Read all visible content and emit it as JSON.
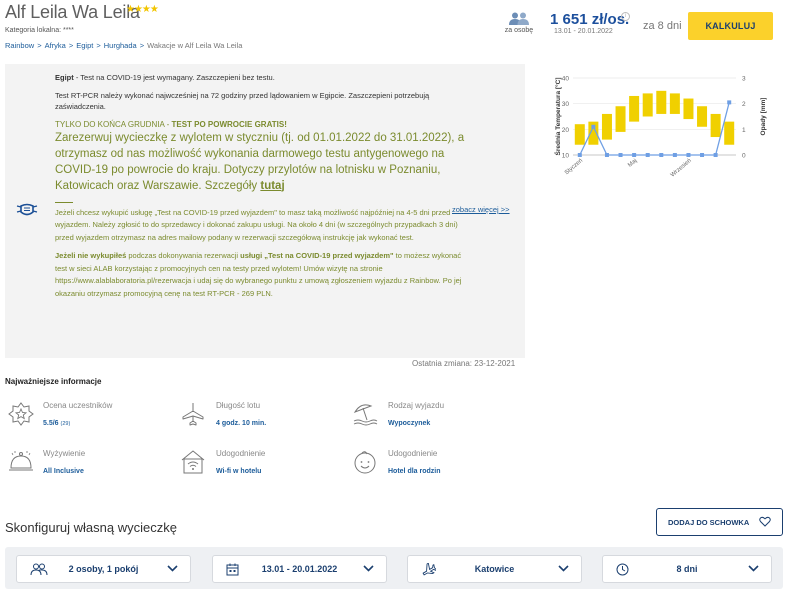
{
  "header": {
    "hotel_name": "Alf Leila Wa Leila",
    "stars": "★★★★",
    "category": "Kategoria lokalna: ****",
    "breadcrumb": [
      "Rainbow",
      "Afryka",
      "Egipt",
      "Hurghada"
    ],
    "breadcrumb_current": "Wakacje w Alf Leila Wa Leila",
    "per_person_label": "za osobę",
    "price": "1 651 zł/os.",
    "price_info_icon": "info-icon",
    "dates": "13.01 - 20.01.2022",
    "days": "za 8 dni",
    "calc_button": "KALKULUJ"
  },
  "covid": {
    "line1_bold": "Egipt",
    "line1": " - Test na COVID-19 jest wymagany. Zaszczepieni bez testu.",
    "line2": "Test RT-PCR należy wykonać najwcześniej na 72 godziny przed lądowaniem w Egipcie. Zaszczepieni potrzebują zaświadczenia.",
    "promo_head": "TYLKO DO KOŃCA GRUDNIA - ",
    "promo_head_bold": "TEST PO POWROCIE GRATIS!",
    "promo_body": "Zarezerwuj wycieczkę z wylotem w styczniu (tj. od 01.01.2022 do 31.01.2022), a otrzymasz od nas możliwość wykonania darmowego testu antygenowego na COVID-19 po powrocie do kraju. Dotyczy przylotów na lotnisku w Poznaniu, Katowicach oraz Warszawie. Szczegóły ",
    "promo_link": "tutaj",
    "see_more": "zobacz więcej >>",
    "p3": "Jeżeli chcesz wykupić usługę „Test na COVID-19 przed wyjazdem\" to masz taką możliwość najpóźniej na 4-5 dni przed wyjazdem. Należy zgłosić to do sprzedawcy i dokonać zakupu usługi. Na około 4 dni (w szczególnych przypadkach 3 dni) przed wyjazdem otrzymasz na adres mailowy podany w rezerwacji szczegółową instrukcję jak wykonać test.",
    "p4_bold1": "Jeżeli nie wykupiłeś",
    "p4_a": " podczas dokonywania rezerwacji ",
    "p4_bold2": "usługi „Test na COVID-19 przed wyjazdem\"",
    "p4_b": " to możesz wykonać test w sieci ALAB korzystając z promocyjnych cen na testy przed wylotem! Umów wizytę na stronie https://www.alablaboratoria.pl/rezerwacja i udaj się do wybranego punktu z umową zgłoszeniem wyjazdu z Rainbow. Po jej okazaniu otrzymasz promocyjną cenę na test RT-PCR - 269 PLN.",
    "last_change": "Ostatnia zmiana: 23-12-2021"
  },
  "chart_data": {
    "type": "bar",
    "title": "",
    "ylabel": "Średnia Temperatura [°C]",
    "y2label": "Opady [mm]",
    "ylim": [
      10,
      40
    ],
    "y2lim": [
      0,
      3
    ],
    "yticks": [
      "40",
      "30",
      "20",
      "10"
    ],
    "y2ticks": [
      "3",
      "2",
      "1",
      "0"
    ],
    "xticks": [
      "Styczeń",
      "Maj",
      "Wrzesień"
    ],
    "colors": {
      "temp": "#f0d000",
      "rain": "#6f9fe4"
    },
    "series": [
      {
        "type": "range-bar",
        "low": [
          14,
          14,
          16,
          19,
          23,
          25,
          26,
          26,
          24,
          21,
          17,
          14
        ],
        "high": [
          22,
          23,
          26,
          29,
          33,
          34,
          35,
          34,
          32,
          29,
          26,
          23
        ]
      },
      {
        "type": "line",
        "values": [
          0,
          1.1,
          0,
          0,
          0,
          0,
          0,
          0,
          0,
          0,
          0,
          2.05
        ]
      }
    ]
  },
  "key_info": {
    "title": "Najważniejsze informacje",
    "items": [
      {
        "label": "Ocena uczestników",
        "value": "5.5/6",
        "value_small": "(29)",
        "icon": "star-badge-icon"
      },
      {
        "label": "Długość lotu",
        "value": "4 godz. 10 min.",
        "icon": "plane-icon"
      },
      {
        "label": "Rodzaj wyjazdu",
        "value": "Wypoczynek",
        "icon": "beach-umbrella-icon"
      },
      {
        "label": "Wyżywienie",
        "value": "All Inclusive",
        "icon": "food-cloche-icon"
      },
      {
        "label": "Udogodnienie",
        "value": "Wi-fi w hotelu",
        "icon": "wifi-icon"
      },
      {
        "label": "Udogodnienie",
        "value": "Hotel dla rodzin",
        "icon": "child-face-icon"
      }
    ]
  },
  "configure": {
    "title": "Skonfiguruj własną wycieczkę",
    "save_button": "DODAJ DO SCHOWKA",
    "dropdowns": [
      {
        "value": "2 osoby, 1 pokój",
        "icon": "people-icon"
      },
      {
        "value": "13.01 - 20.01.2022",
        "icon": "calendar-icon"
      },
      {
        "value": "Katowice",
        "icon": "plane-icon"
      },
      {
        "value": "8 dni",
        "icon": "clock-icon"
      }
    ]
  }
}
